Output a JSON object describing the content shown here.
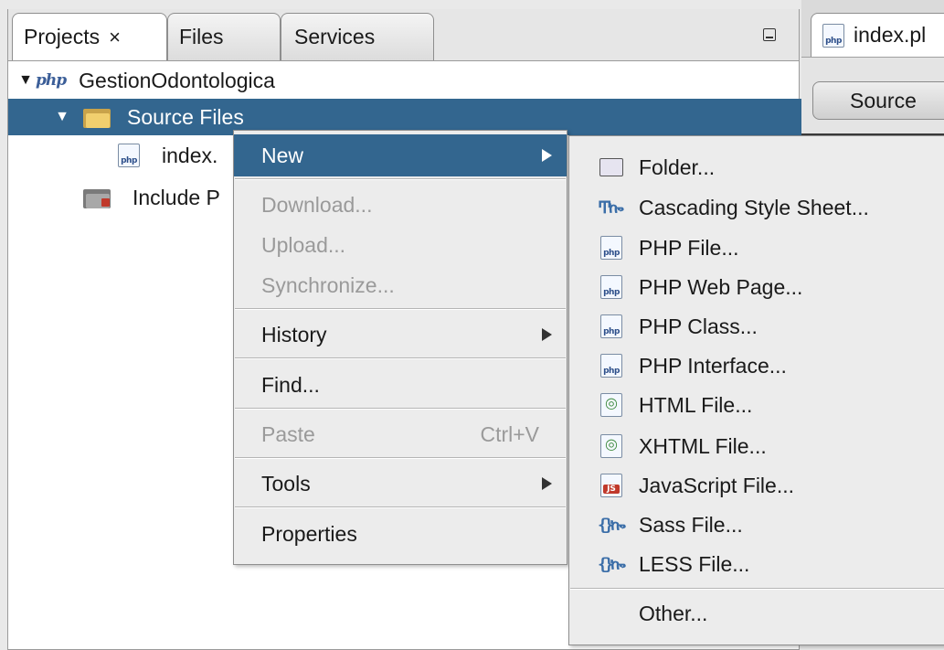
{
  "projects_panel": {
    "tabs": [
      {
        "label": "Projects",
        "close": "×",
        "active": true
      },
      {
        "label": "Files",
        "active": false
      },
      {
        "label": "Services",
        "active": false
      }
    ],
    "tree": {
      "project": {
        "expand": "▼",
        "icon": "php-logo-icon",
        "logo_text": "php",
        "label": "GestionOdontologica"
      },
      "source_files": {
        "expand": "▼",
        "icon": "source-folder-icon",
        "label": "Source Files",
        "selected": true
      },
      "index_file": {
        "icon": "php-file-icon",
        "label": "index."
      },
      "include_path": {
        "icon": "include-folder-icon",
        "label": "Include P"
      }
    }
  },
  "editor": {
    "tab_label": "index.pl",
    "source_button": "Source"
  },
  "context_menu": {
    "items": [
      {
        "label": "New",
        "highlighted": true,
        "submenu": true
      },
      {
        "label": "Download...",
        "disabled": true
      },
      {
        "label": "Upload...",
        "disabled": true
      },
      {
        "label": "Synchronize...",
        "disabled": true
      },
      {
        "label": "History",
        "submenu": true
      },
      {
        "label": "Find..."
      },
      {
        "label": "Paste",
        "shortcut": "Ctrl+V",
        "disabled": true
      },
      {
        "label": "Tools",
        "submenu": true
      },
      {
        "label": "Properties"
      }
    ]
  },
  "new_submenu": {
    "items": [
      {
        "label": "Folder...",
        "icon": "folder-icon"
      },
      {
        "label": "Cascading Style Sheet...",
        "icon": "css-icon"
      },
      {
        "label": "PHP File...",
        "icon": "php-file-icon"
      },
      {
        "label": "PHP Web Page...",
        "icon": "php-file-icon"
      },
      {
        "label": "PHP Class...",
        "icon": "php-file-icon"
      },
      {
        "label": "PHP Interface...",
        "icon": "php-file-icon"
      },
      {
        "label": "HTML File...",
        "icon": "html-file-icon"
      },
      {
        "label": "XHTML File...",
        "icon": "html-file-icon"
      },
      {
        "label": "JavaScript File...",
        "icon": "javascript-file-icon"
      },
      {
        "label": "Sass File...",
        "icon": "sass-file-icon"
      },
      {
        "label": "LESS File...",
        "icon": "less-file-icon"
      },
      {
        "label": "Other..."
      }
    ]
  },
  "colors": {
    "selection": "#33668f",
    "menu_background": "#ececec",
    "disabled_text": "#9a9a9a"
  }
}
